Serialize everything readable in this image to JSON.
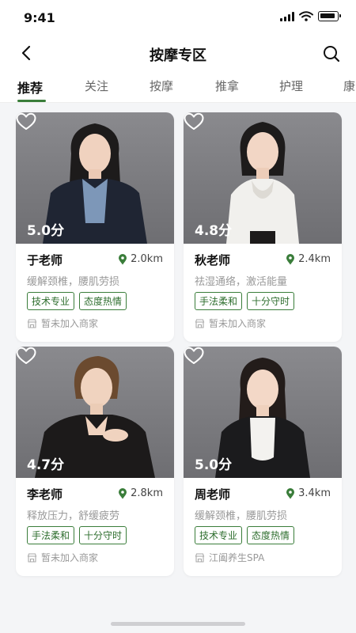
{
  "status_bar": {
    "time": "9:41"
  },
  "header": {
    "title": "按摩专区"
  },
  "tabs": [
    {
      "label": "推荐",
      "active": true
    },
    {
      "label": "关注"
    },
    {
      "label": "按摩"
    },
    {
      "label": "推拿"
    },
    {
      "label": "护理"
    },
    {
      "label": "康"
    }
  ],
  "therapists": [
    {
      "name": "于老师",
      "rating": "5.0分",
      "distance": "2.0km",
      "description": "缓解颈椎，腰肌劳损",
      "tags": [
        "技术专业",
        "态度热情"
      ],
      "shop": "暂未加入商家"
    },
    {
      "name": "秋老师",
      "rating": "4.8分",
      "distance": "2.4km",
      "description": "祛湿通络，激活能量",
      "tags": [
        "手法柔和",
        "十分守时"
      ],
      "shop": "暂未加入商家"
    },
    {
      "name": "李老师",
      "rating": "4.7分",
      "distance": "2.8km",
      "description": "释放压力，舒缓疲劳",
      "tags": [
        "手法柔和",
        "十分守时"
      ],
      "shop": "暂未加入商家"
    },
    {
      "name": "周老师",
      "rating": "5.0分",
      "distance": "3.4km",
      "description": "缓解颈椎，腰肌劳损",
      "tags": [
        "技术专业",
        "态度热情"
      ],
      "shop": "江阖养生SPA"
    }
  ],
  "colors": {
    "accent": "#3a7d3a",
    "background": "#f4f5f7"
  },
  "icons": {
    "back": "chevron-left-icon",
    "search": "search-icon",
    "favorite": "heart-icon",
    "location": "location-pin-icon",
    "shop": "store-icon"
  }
}
